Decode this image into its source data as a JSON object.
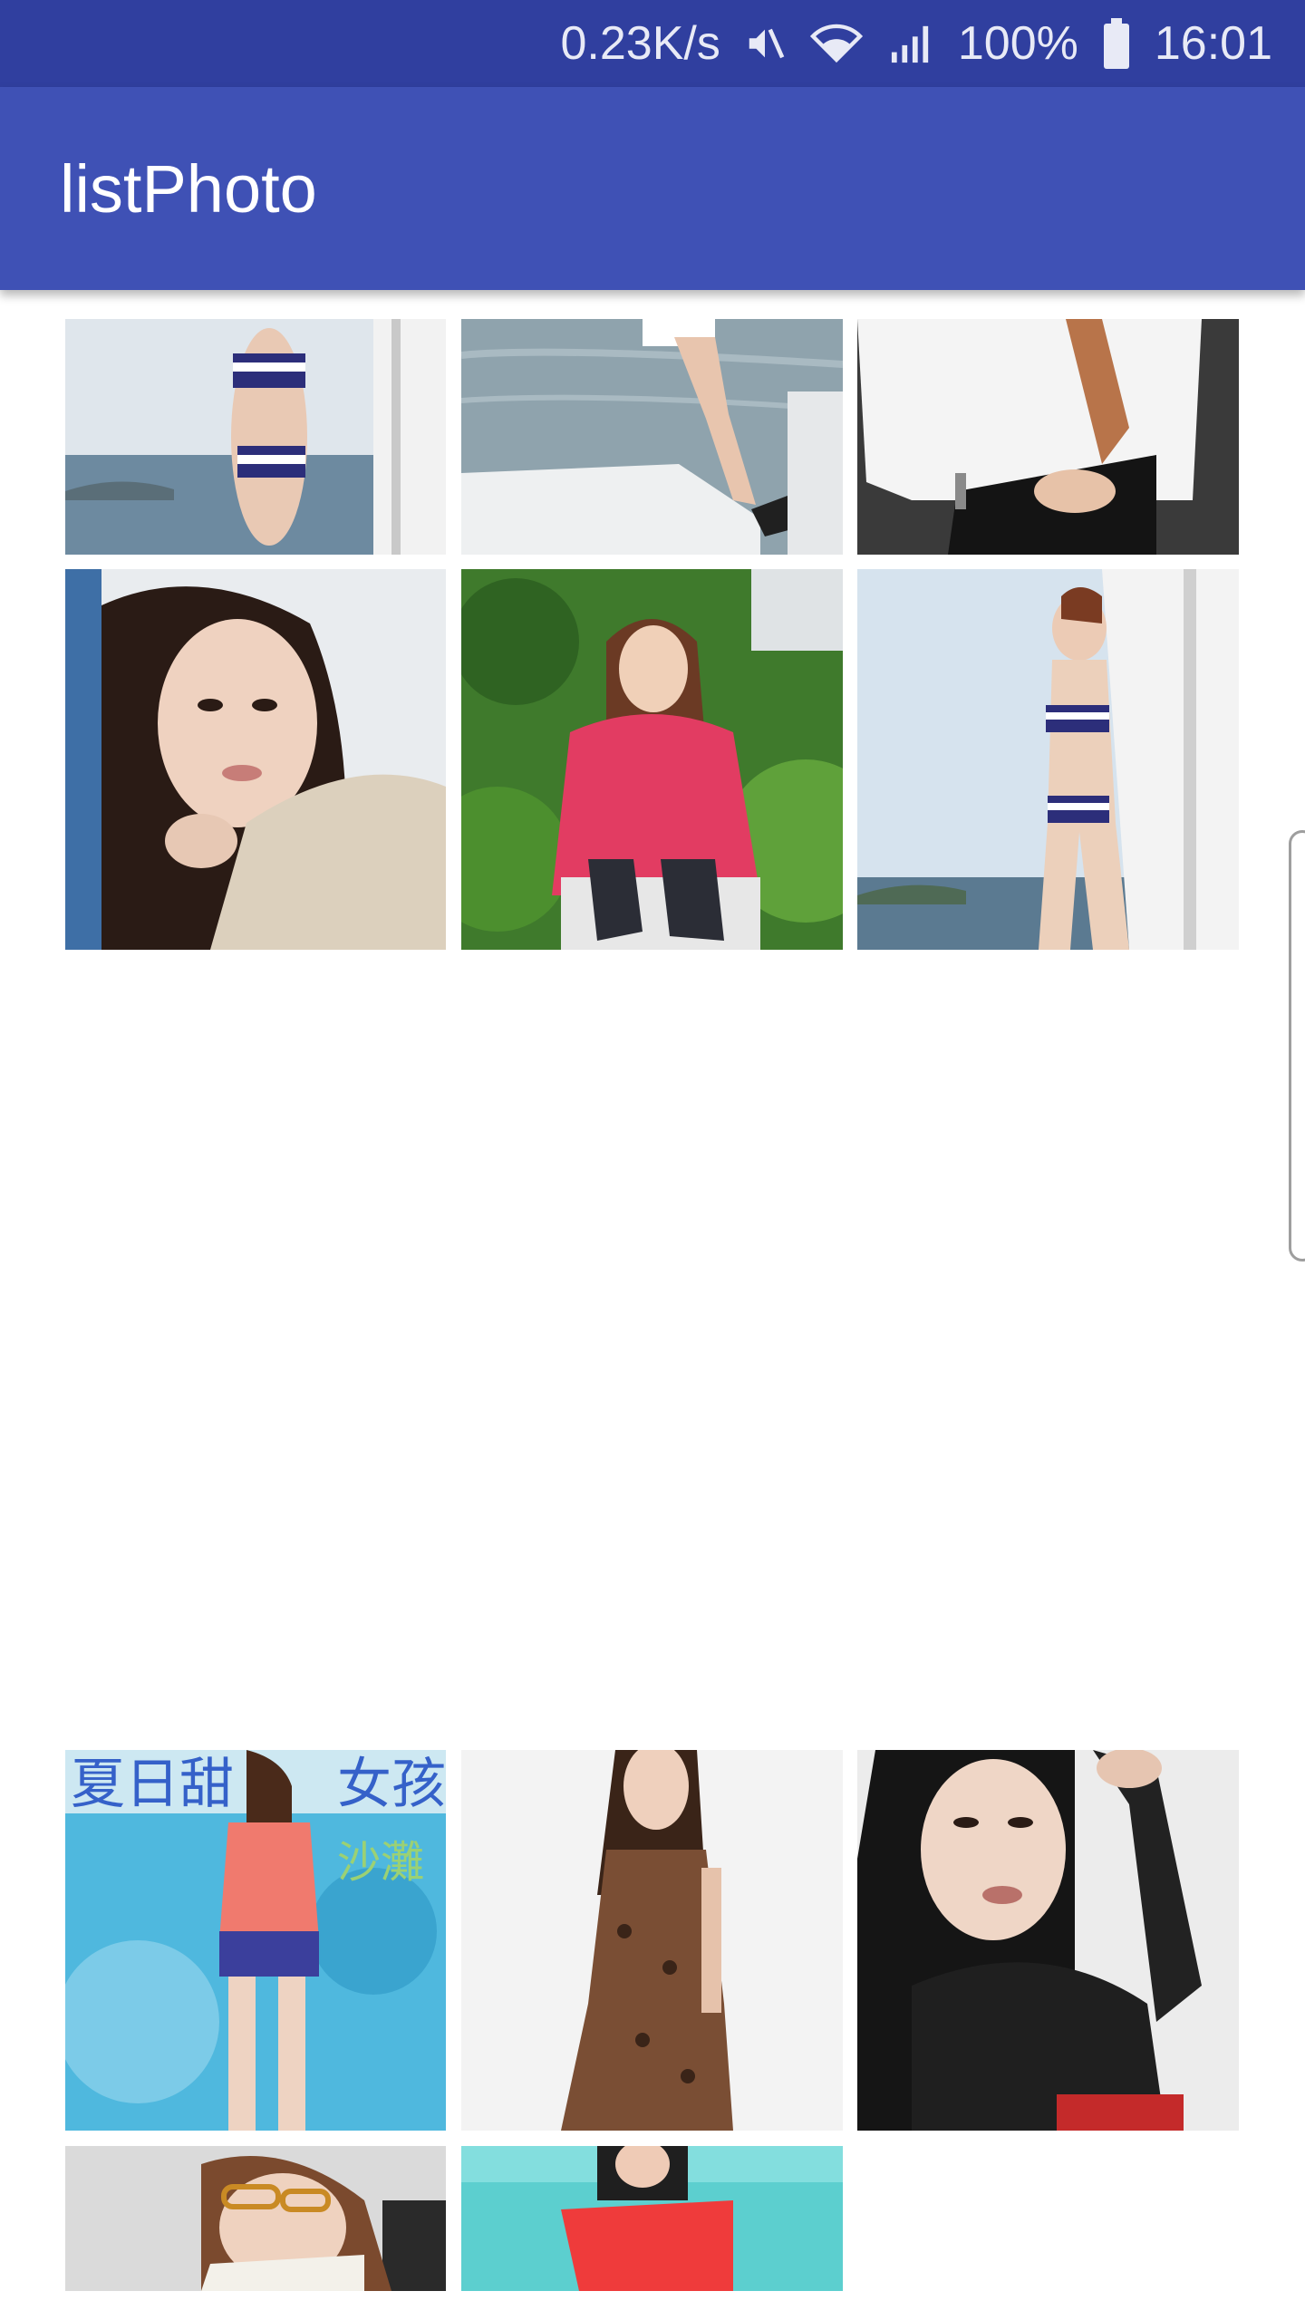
{
  "status_bar": {
    "net_speed": "0.23K/s",
    "mute_icon": "mute-icon",
    "wifi_icon": "wifi-icon",
    "signal_icon": "signal-icon",
    "battery": "100%",
    "battery_icon": "battery-icon",
    "time": "16:01"
  },
  "app_bar": {
    "title": "listPhoto",
    "color": "#3f51b5",
    "status_color": "#303f9f"
  },
  "gallery": {
    "photos": [
      {
        "subject": "bikini on boat"
      },
      {
        "subject": "legs on boat deck"
      },
      {
        "subject": "white blouse black skirt"
      },
      {
        "subject": "woman in beige sweater"
      },
      {
        "subject": "pink top sitting in garden"
      },
      {
        "subject": "bikini on boat wide"
      },
      {
        "subject": "pink top blue shorts poster"
      },
      {
        "subject": "leopard print dress"
      },
      {
        "subject": "fishnet top portrait"
      },
      {
        "subject": "glasses portrait"
      },
      {
        "subject": "red dress seaside"
      }
    ],
    "poster_text": [
      "夏日甜",
      "女孩",
      "沙灘"
    ]
  }
}
